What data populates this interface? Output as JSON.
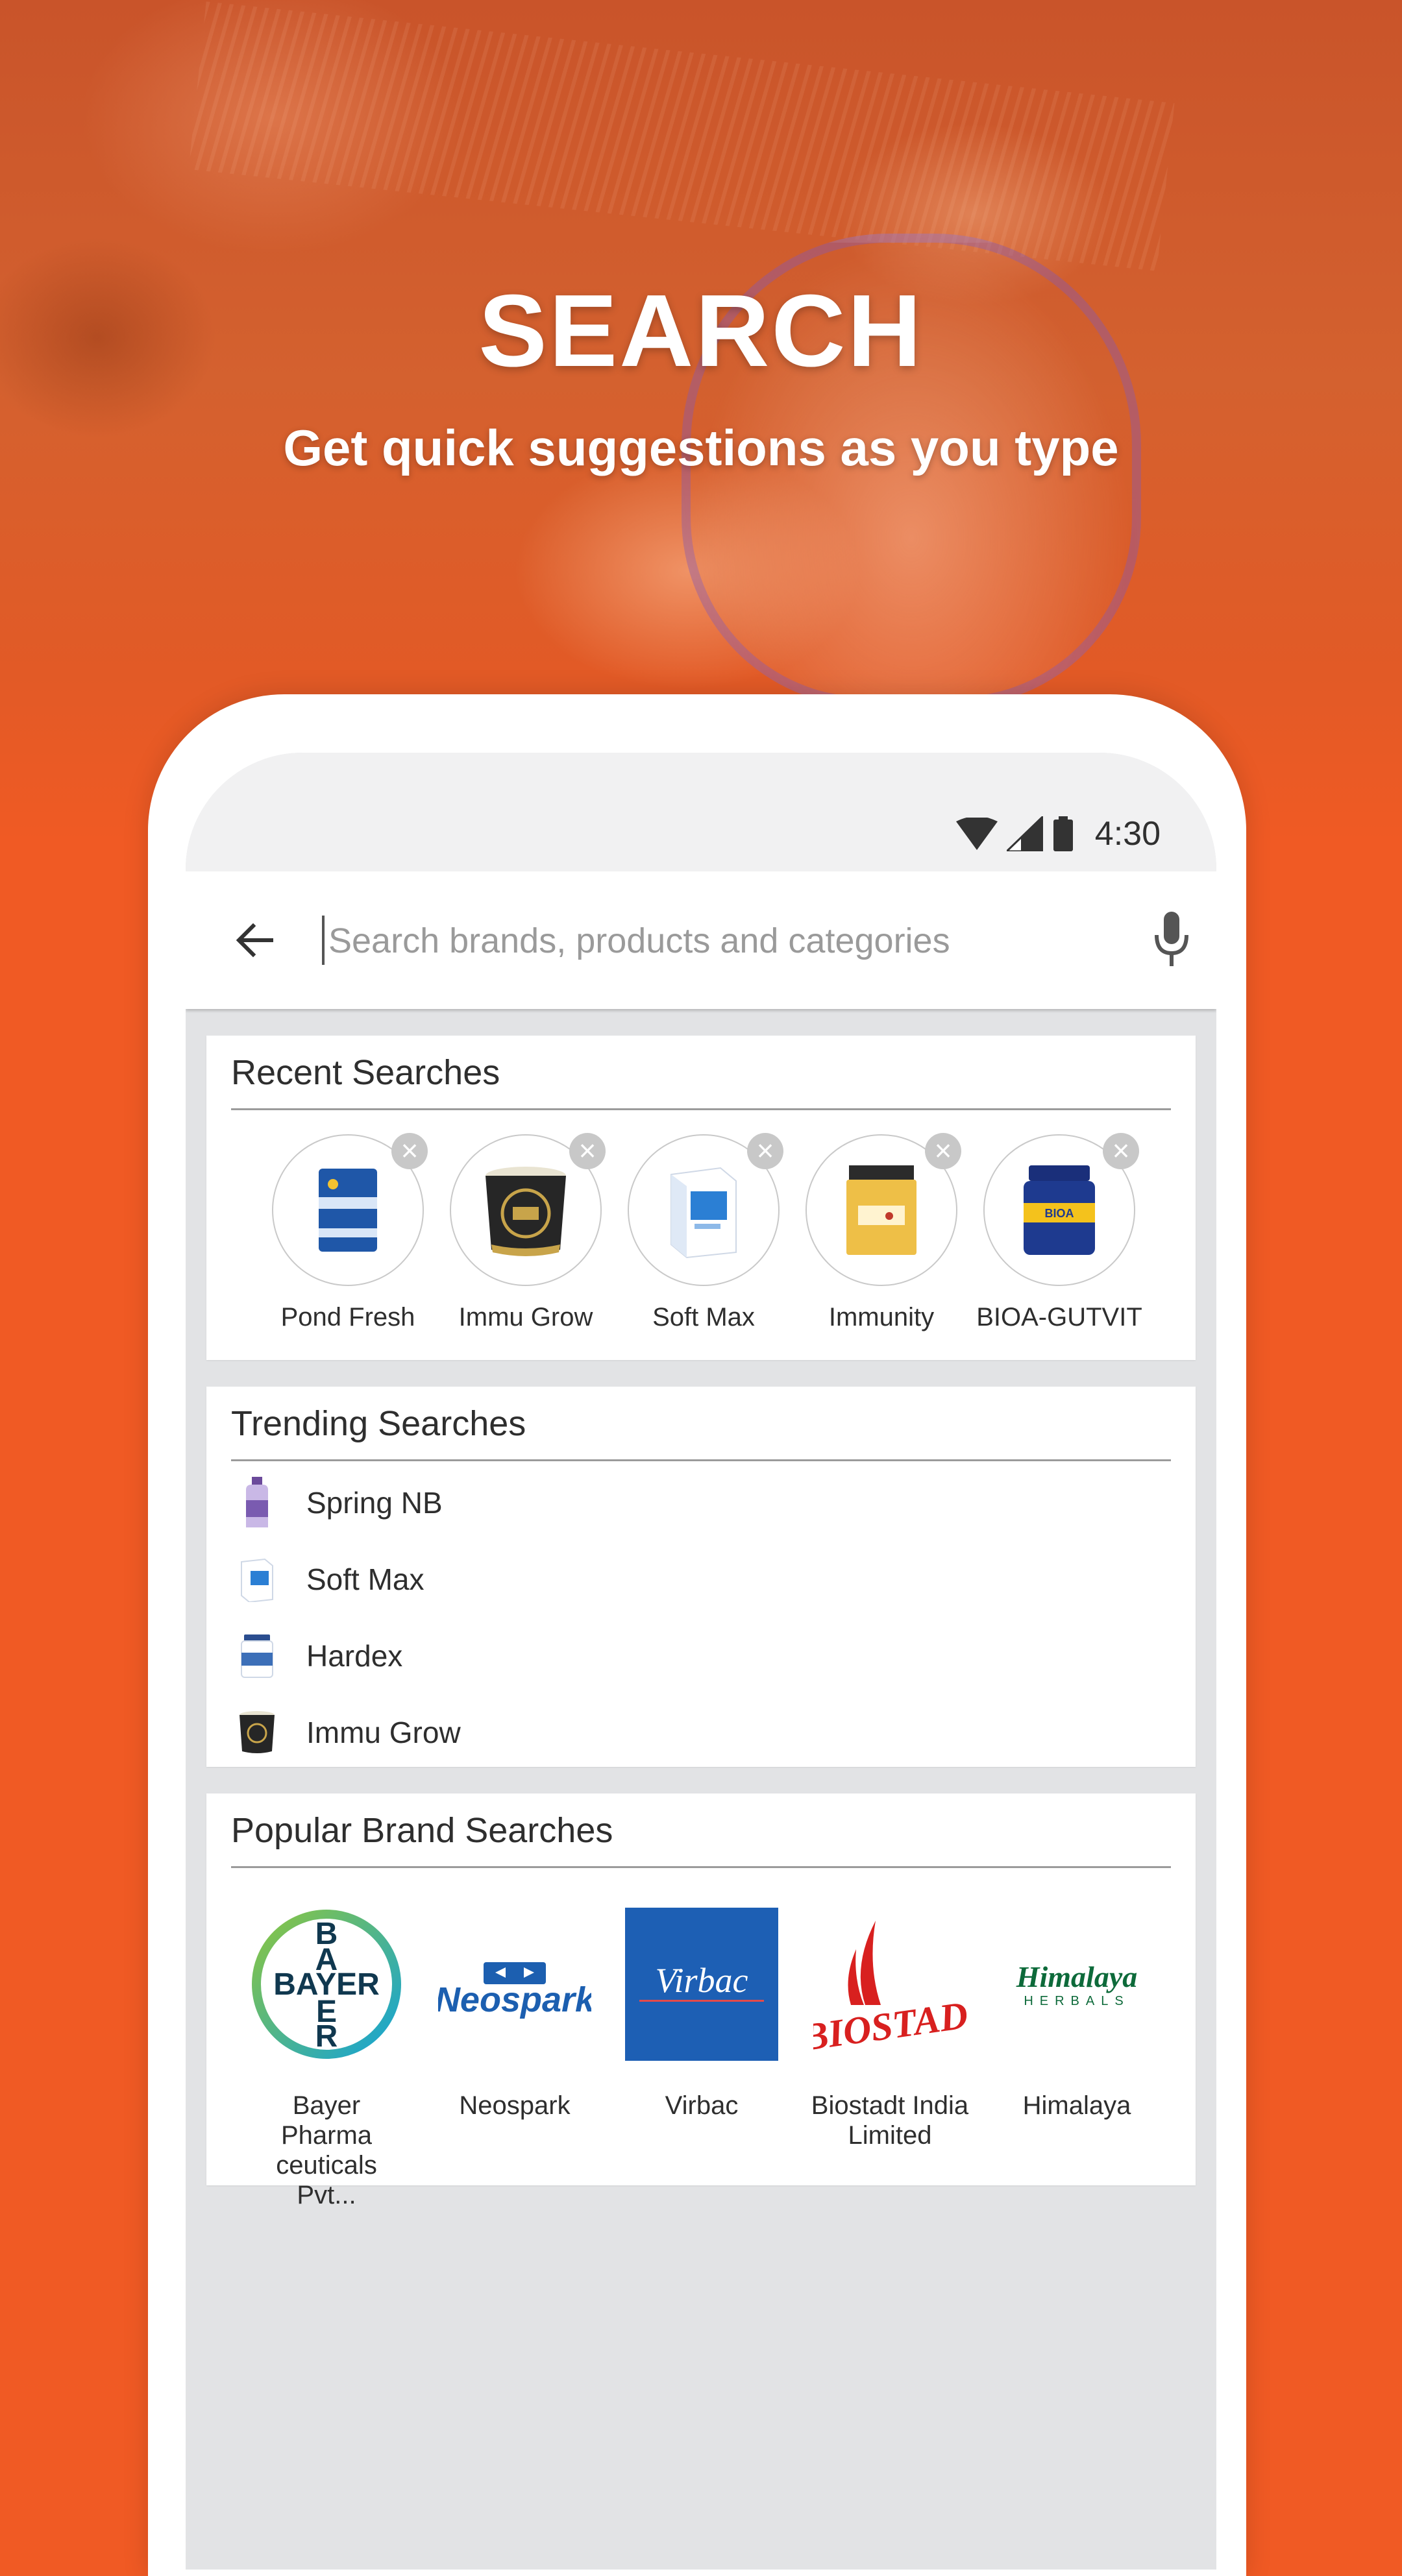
{
  "hero": {
    "title": "SEARCH",
    "subtitle": "Get quick suggestions as you type"
  },
  "status_bar": {
    "time": "4:30",
    "icons": [
      "wifi-icon",
      "signal-icon",
      "battery-icon"
    ]
  },
  "search": {
    "placeholder": "Search brands, products and categories",
    "value": "",
    "back_icon": "arrow-left-icon",
    "mic_icon": "mic-icon"
  },
  "recent": {
    "title": "Recent Searches",
    "items": [
      {
        "label": "Pond Fresh",
        "icon": "product-packet"
      },
      {
        "label": "Immu Grow",
        "icon": "product-bucket"
      },
      {
        "label": "Soft Max",
        "icon": "product-box"
      },
      {
        "label": "Immunity",
        "icon": "product-jar"
      },
      {
        "label": "BIOA-GUTVIT",
        "icon": "product-tub"
      }
    ]
  },
  "trending": {
    "title": "Trending Searches",
    "items": [
      {
        "label": "Spring NB",
        "icon": "product-bottle"
      },
      {
        "label": "Soft Max",
        "icon": "product-box"
      },
      {
        "label": "Hardex",
        "icon": "product-tub"
      },
      {
        "label": "Immu Grow",
        "icon": "product-bucket"
      }
    ]
  },
  "brands": {
    "title": "Popular Brand Searches",
    "items": [
      {
        "label": "Bayer Pharma ceuticals Pvt...",
        "logo_text": "BAYER",
        "color": "#10384f"
      },
      {
        "label": "Neospark",
        "logo_text": "Neospark",
        "color": "#1c5fb0"
      },
      {
        "label": "Virbac",
        "logo_text": "Virbac",
        "color": "#1d5fb4"
      },
      {
        "label": "Biostadt India Limited",
        "logo_text": "BIOSTADT",
        "color": "#d8201f"
      },
      {
        "label": "Himalaya",
        "logo_text": "Himalaya",
        "logo_sub": "HERBALS",
        "color": "#0d6a3a"
      }
    ]
  },
  "colors": {
    "accent": "#f05a24",
    "screen_bg": "#e2e3e5",
    "card_bg": "#ffffff"
  }
}
